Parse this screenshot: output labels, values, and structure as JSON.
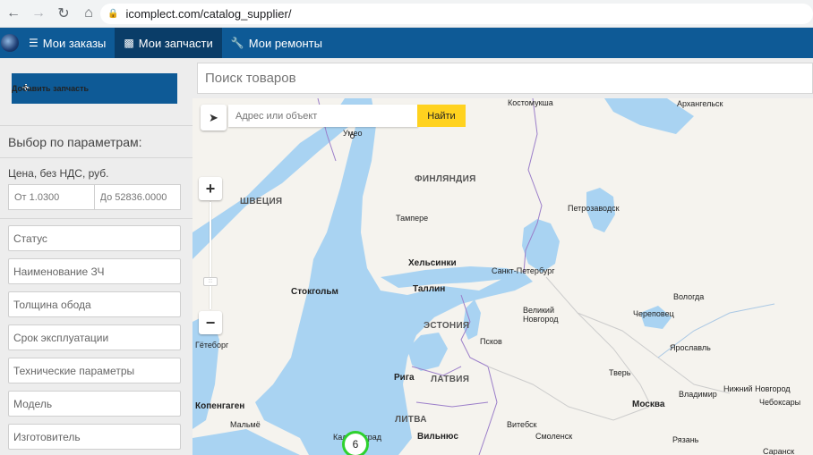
{
  "browser": {
    "url": "icomplect.com/catalog_supplier/"
  },
  "nav": {
    "items": [
      {
        "label": "Мои заказы",
        "icon": "list-icon"
      },
      {
        "label": "Мои запчасти",
        "icon": "sitemap-icon"
      },
      {
        "label": "Мои ремонты",
        "icon": "wrench-icon"
      }
    ]
  },
  "sidebar": {
    "add_button": "Добавить запчасть",
    "filter_title": "Выбор по параметрам:",
    "price_label": "Цена, без НДС, руб.",
    "price_from_placeholder": "От 1.0300",
    "price_to_placeholder": "До 52836.0000",
    "filters": [
      "Статус",
      "Наименование ЗЧ",
      "Толщина обода",
      "Срок эксплуатации",
      "Технические параметры",
      "Модель",
      "Изготовитель"
    ]
  },
  "search": {
    "placeholder": "Поиск товаров"
  },
  "map": {
    "address_placeholder": "Адрес или объект",
    "find_button": "Найти",
    "zoom_in": "+",
    "zoom_out": "−",
    "cluster_count": "6",
    "labels": {
      "kostomuksha": "Костомукша",
      "arkhangelsk": "Архангельск",
      "umeo": "Умео",
      "finland": "ФИНЛЯНДИЯ",
      "sweden": "ШВЕЦИЯ",
      "tampere": "Тампере",
      "petrozavodsk": "Петрозаводск",
      "helsinki": "Хельсинки",
      "spb": "Санкт-Петербург",
      "stockholm": "Стокгольм",
      "tallinn": "Таллин",
      "vologda": "Вологда",
      "estonia": "ЭСТОНИЯ",
      "velikiy_novgorod": "Великий Новгород",
      "cherepovets": "Череповец",
      "pskov": "Псков",
      "goteborg": "Гётеборг",
      "yaroslavl": "Ярославль",
      "riga": "Рига",
      "latvia": "ЛАТВИЯ",
      "tver": "Тверь",
      "kopenhagen": "Копенгаген",
      "vladimir": "Владимир",
      "nizhny": "Нижний Новгород",
      "moscow": "Москва",
      "cheboksary": "Чебоксары",
      "lithuania": "ЛИТВА",
      "vitebsk": "Витебск",
      "malme": "Мальмё",
      "vilnius": "Вильнюс",
      "smolensk": "Смоленск",
      "kaliningrad": "Калининград",
      "ryazan": "Рязань",
      "saransk": "Саранск"
    }
  },
  "colors": {
    "brand": "#0e5a96",
    "brand_dark": "#0a3d68",
    "water": "#a9d3f2",
    "land": "#f5f3ee",
    "find_button": "#ffd21f",
    "cluster": "#2ed12e"
  }
}
